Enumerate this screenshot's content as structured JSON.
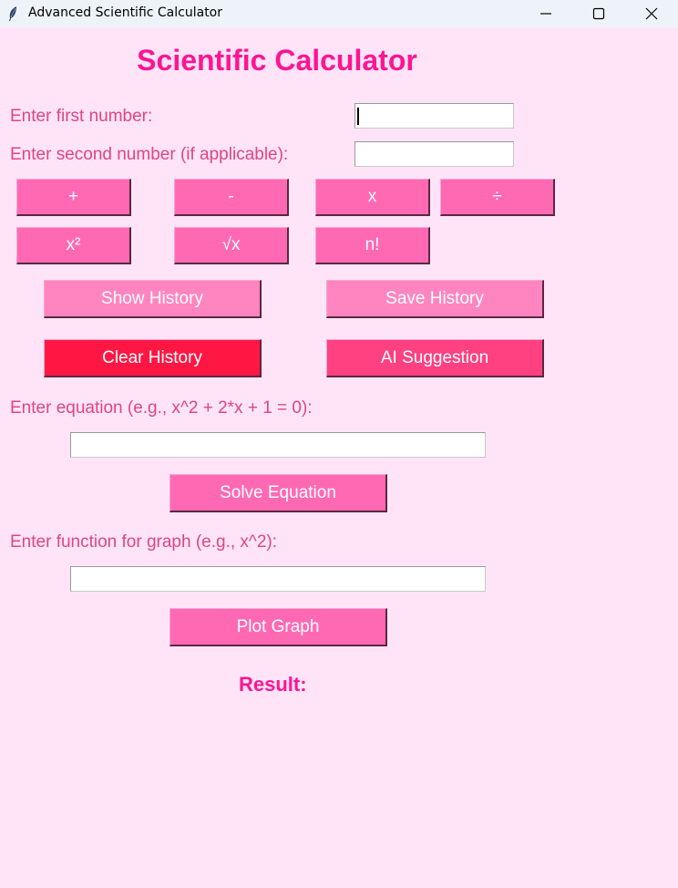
{
  "window": {
    "title": "Advanced Scientific Calculator",
    "controls": {
      "minimize": "—",
      "maximize": "☐",
      "close": "✕"
    }
  },
  "app_title": "Scientific Calculator",
  "labels": {
    "first_number": "Enter first number:",
    "second_number": "Enter second number (if applicable):",
    "equation": "Enter equation (e.g., x^2 + 2*x + 1 = 0):",
    "graph_function": "Enter function for graph (e.g., x^2):",
    "result": "Result:"
  },
  "inputs": {
    "first_number": "",
    "second_number": "",
    "equation": "",
    "graph_function": ""
  },
  "operations": {
    "add": "+",
    "subtract": "-",
    "multiply": "x",
    "divide": "÷",
    "square": "x²",
    "sqrt": "√x",
    "factorial": "n!"
  },
  "actions": {
    "show_history": "Show History",
    "save_history": "Save History",
    "clear_history": "Clear History",
    "ai_suggestion": "AI Suggestion",
    "solve_equation": "Solve Equation",
    "plot_graph": "Plot Graph"
  },
  "colors": {
    "background": "#ffe4f8",
    "accent": "#ff1493",
    "label": "#e0457e",
    "button": "#ff69b4",
    "history_button": "#ff85c0",
    "clear_button": "#ff1744",
    "ai_button": "#ff4081"
  }
}
